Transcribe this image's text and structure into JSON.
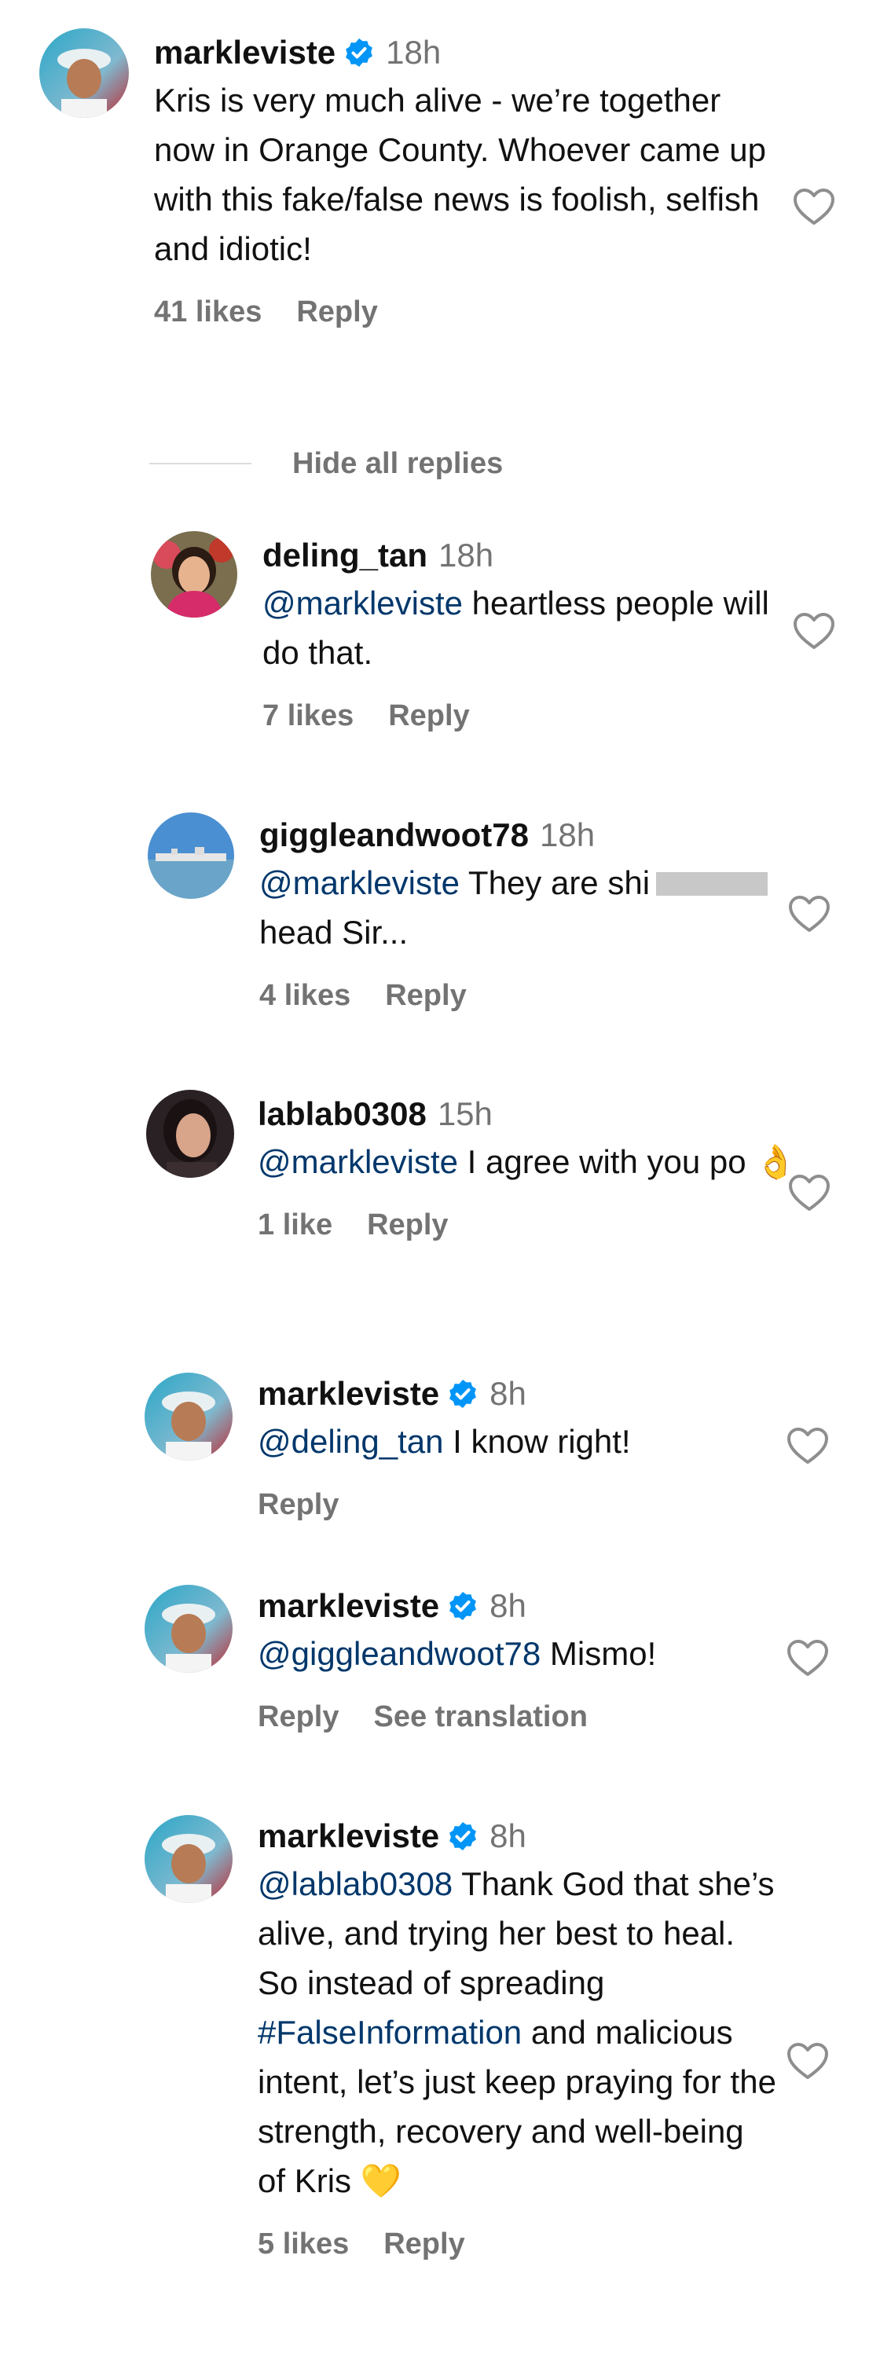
{
  "colors": {
    "accent_link": "#00376b",
    "secondary_text": "#737373",
    "verified_blue": "#0095f6",
    "heart_outline": "#8e8e8e"
  },
  "comment_main": {
    "username": "markleviste",
    "verified": true,
    "time": "18h",
    "text": "Kris is very much alive - we’re together now in Orange County. Whoever came up with this fake/false news is foolish, selfish and idiotic!",
    "likes": "41 likes",
    "reply": "Reply"
  },
  "hide_replies": "Hide all replies",
  "replies": [
    {
      "username": "deling_tan",
      "verified": false,
      "time": "18h",
      "mention": "@markleviste",
      "text": " heartless people will do that.",
      "likes": "7 likes",
      "reply": "Reply"
    },
    {
      "username": "giggleandwoot78",
      "verified": false,
      "time": "18h",
      "mention": "@markleviste",
      "text": " They are shi",
      "text_after": " head Sir...",
      "likes": "4 likes",
      "reply": "Reply"
    },
    {
      "username": "lablab0308",
      "verified": false,
      "time": "15h",
      "mention": "@markleviste",
      "text": " I agree with you po ",
      "emoji": "👌",
      "likes": "1 like",
      "reply": "Reply"
    },
    {
      "username": "markleviste",
      "verified": true,
      "time": "8h",
      "mention": "@deling_tan",
      "text": " I know right!",
      "reply": "Reply"
    },
    {
      "username": "markleviste",
      "verified": true,
      "time": "8h",
      "mention": "@giggleandwoot78",
      "text": " Mismo!",
      "reply": "Reply",
      "translation": "See translation"
    },
    {
      "username": "markleviste",
      "verified": true,
      "time": "8h",
      "mention": "@lablab0308",
      "text": " Thank God that she’s alive, and trying her best to heal. So instead of spreading ",
      "hashtag": "#FalseInformation",
      "text_after": " and malicious intent, let’s just keep praying for the strength, recovery and well-being of Kris ",
      "emoji": "💛",
      "likes": "5 likes",
      "reply": "Reply"
    }
  ]
}
